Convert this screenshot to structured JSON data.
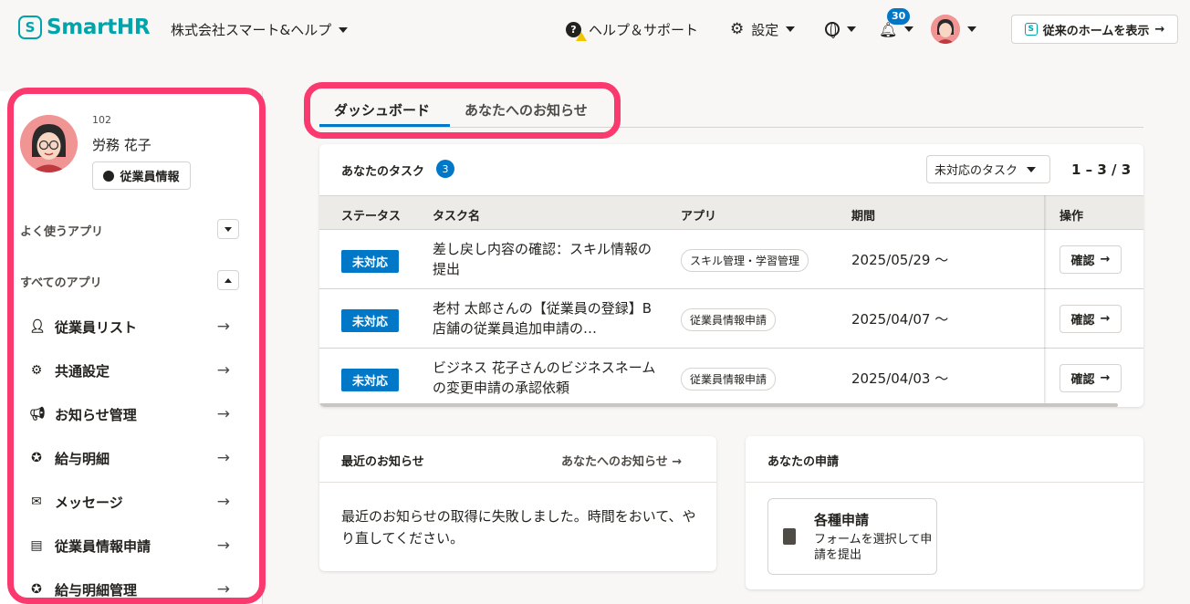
{
  "header": {
    "logo_mark": "S",
    "logo_text": "SmartHR",
    "company": "株式会社スマート&ヘルプ",
    "help": "ヘルプ＆サポート",
    "settings": "設定",
    "notifications_count": "30",
    "home_button": "従来のホームを表示",
    "home_mark": "S",
    "arrow": "→"
  },
  "sidebar": {
    "employee_no": "102",
    "employee_name": "労務 花子",
    "employee_info_button": "従業員情報",
    "frequent_apps": "よく使うアプリ",
    "all_apps": "すべてのアプリ",
    "items": [
      {
        "label": "従業員リスト",
        "icon": "person-icon"
      },
      {
        "label": "共通設定",
        "icon": "gear-icon"
      },
      {
        "label": "お知らせ管理",
        "icon": "megaphone-icon"
      },
      {
        "label": "給与明細",
        "icon": "payslip-icon"
      },
      {
        "label": "メッセージ",
        "icon": "envelope-icon"
      },
      {
        "label": "従業員情報申請",
        "icon": "request-icon"
      },
      {
        "label": "給与明細管理",
        "icon": "payslip-admin-icon"
      }
    ],
    "arrow": "→"
  },
  "tabs": [
    {
      "label": "ダッシュボード",
      "active": true
    },
    {
      "label": "あなたへのお知らせ",
      "active": false
    }
  ],
  "tasks": {
    "title": "あなたのタスク",
    "count": "3",
    "filter": "未対応のタスク",
    "pager": "1 – 3 / 3",
    "columns": [
      "ステータス",
      "タスク名",
      "アプリ",
      "期間",
      "操作"
    ],
    "rows": [
      {
        "status": "未対応",
        "name": "差し戻し内容の確認：スキル情報の提出",
        "app": "スキル管理・学習管理",
        "period": "2025/05/29 〜",
        "action": "確認"
      },
      {
        "status": "未対応",
        "name": "老村 太郎さんの【従業員の登録】B店舗の従業員追加申請の…",
        "app": "従業員情報申請",
        "period": "2025/04/07 〜",
        "action": "確認"
      },
      {
        "status": "未対応",
        "name": "ビジネス 花子さんのビジネスネームの変更申請の承認依頼",
        "app": "従業員情報申請",
        "period": "2025/04/03 〜",
        "action": "確認"
      }
    ]
  },
  "news": {
    "title": "最近のお知らせ",
    "link": "あなたへのお知らせ",
    "message": "最近のお知らせの取得に失敗しました。時間をおいて、やり直してください。"
  },
  "requests": {
    "title": "あなたの申請",
    "tile_title": "各種申請",
    "tile_desc": "フォームを選択して申請を提出"
  },
  "colors": {
    "brand": "#00a5ab",
    "accent": "#0077c7",
    "highlight_frame": "#fa3a6e"
  }
}
